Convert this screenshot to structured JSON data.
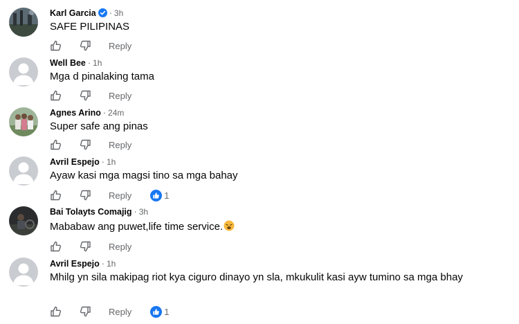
{
  "comments": [
    {
      "name": "Karl Garcia",
      "verified": true,
      "time": "3h",
      "text": "SAFE PILIPINAS",
      "reply_label": "Reply",
      "reaction_count": ""
    },
    {
      "name": "Well Bee",
      "verified": false,
      "time": "1h",
      "text": "Mga d pinalaking tama",
      "reply_label": "Reply",
      "reaction_count": ""
    },
    {
      "name": "Agnes Arino",
      "verified": false,
      "time": "24m",
      "text": "Super safe ang pinas",
      "reply_label": "Reply",
      "reaction_count": ""
    },
    {
      "name": "Avril Espejo",
      "verified": false,
      "time": "1h",
      "text": "Ayaw kasi mga magsi tino sa mga bahay",
      "reply_label": "Reply",
      "reaction_count": "1"
    },
    {
      "name": "Bai Tolayts Comajig",
      "verified": false,
      "time": "3h",
      "text": "Mababaw ang puwet,life time service.",
      "text_emoji": "weary-face",
      "reply_label": "Reply",
      "reaction_count": ""
    },
    {
      "name": "Avril Espejo",
      "verified": false,
      "time": "1h",
      "text": "Mhilg yn sila makipag riot kya ciguro dinayo yn sla, mkukulit kasi ayw tumino sa mga bhay",
      "reply_label": "Reply",
      "reaction_count": "1"
    }
  ],
  "separator": "·",
  "colors": {
    "meta": "#65676b",
    "text": "#050505",
    "like_blue": "#1877f2",
    "default_avatar_bg": "#c9ccd1",
    "icon_stroke": "#65676b"
  },
  "icons": {
    "like": "thumbs-up-outline-icon",
    "dislike": "thumbs-down-outline-icon",
    "reaction": "like-reaction-icon",
    "verified": "verified-badge-icon"
  }
}
